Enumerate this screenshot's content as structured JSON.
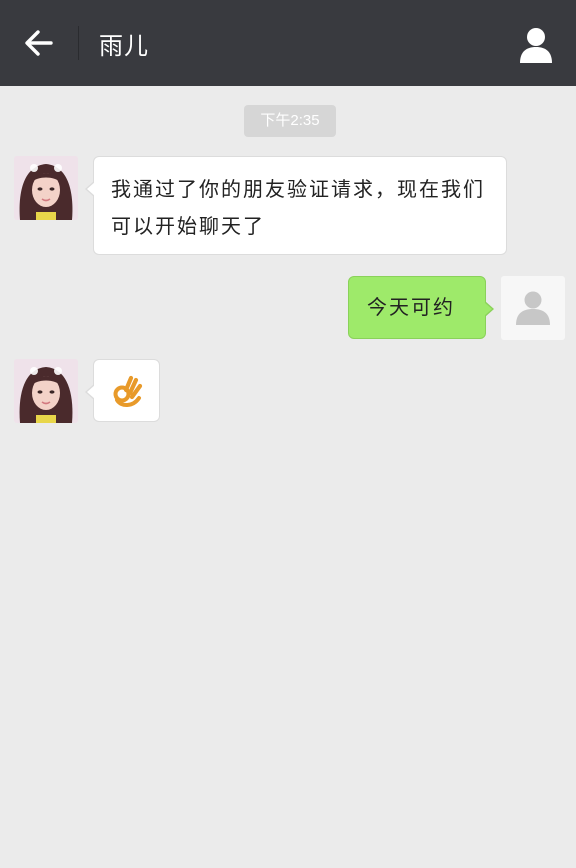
{
  "header": {
    "title": "雨儿",
    "back_icon": "arrow-left-icon",
    "profile_icon": "person-icon"
  },
  "timestamp": "下午2:35",
  "messages": [
    {
      "sender": "contact",
      "avatar_icon": "contact-avatar",
      "text": "我通过了你的朋友验证请求，现在我们可以开始聊天了"
    },
    {
      "sender": "me",
      "avatar_icon": "default-user-avatar",
      "text": "今天可约"
    },
    {
      "sender": "contact",
      "avatar_icon": "contact-avatar",
      "emoji_icon": "ok-hand-icon"
    }
  ],
  "colors": {
    "header_bg": "#393a3f",
    "chat_bg": "#ebebeb",
    "outgoing_bubble": "#9eea6a",
    "incoming_bubble": "#ffffff",
    "timestamp_bg": "#d6d6d6"
  }
}
